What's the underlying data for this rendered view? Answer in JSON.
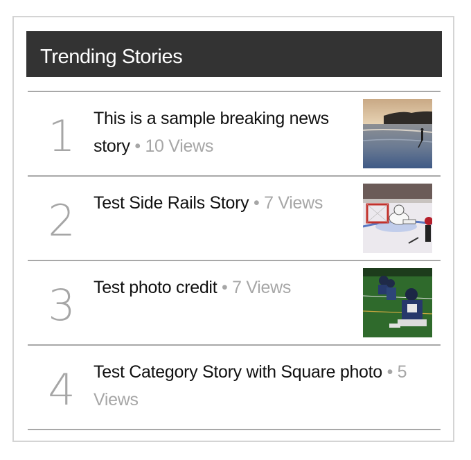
{
  "widget": {
    "title": "Trending Stories",
    "separator": "•",
    "stories": [
      {
        "rank": "1",
        "title": "This is a sample breaking news story",
        "views": "10 Views",
        "image": "beach-shore-thumbnail"
      },
      {
        "rank": "2",
        "title": "Test Side Rails Story",
        "views": "7 Views",
        "image": "hockey-goalie-thumbnail"
      },
      {
        "rank": "3",
        "title": "Test photo credit",
        "views": "7 Views",
        "image": "football-players-thumbnail"
      },
      {
        "rank": "4",
        "title": "Test Category Story with Square photo",
        "views": "5 Views",
        "image": ""
      }
    ]
  }
}
